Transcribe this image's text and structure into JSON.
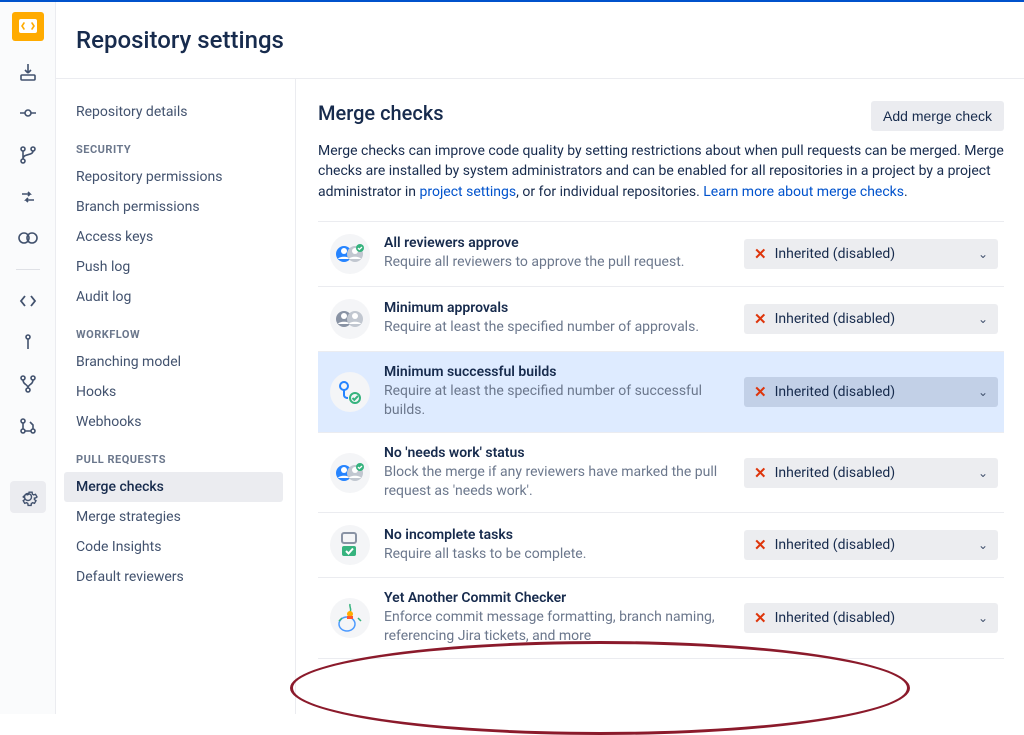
{
  "header": {
    "title": "Repository settings"
  },
  "settings_nav": {
    "top_item": "Repository details",
    "groups": [
      {
        "title": "SECURITY",
        "items": [
          "Repository permissions",
          "Branch permissions",
          "Access keys",
          "Push log",
          "Audit log"
        ]
      },
      {
        "title": "WORKFLOW",
        "items": [
          "Branching model",
          "Hooks",
          "Webhooks"
        ]
      },
      {
        "title": "PULL REQUESTS",
        "items": [
          "Merge checks",
          "Merge strategies",
          "Code Insights",
          "Default reviewers"
        ]
      }
    ],
    "active_item": "Merge checks"
  },
  "main": {
    "title": "Merge checks",
    "add_button": "Add merge check",
    "description_parts": {
      "pre": "Merge checks can improve code quality by setting restrictions about when pull requests can be merged. Merge checks are installed by system administrators and can be enabled for all repositories in a project by a project administrator in ",
      "link1": "project settings",
      "mid": ", or for individual repositories. ",
      "link2": "Learn more about merge checks",
      "post": "."
    },
    "checks": [
      {
        "title": "All reviewers approve",
        "desc": "Require all reviewers to approve the pull request.",
        "status": "Inherited (disabled)",
        "highlight": false,
        "icon": "avatars"
      },
      {
        "title": "Minimum approvals",
        "desc": "Require at least the specified number of approvals.",
        "status": "Inherited (disabled)",
        "highlight": false,
        "icon": "avatars-gray"
      },
      {
        "title": "Minimum successful builds",
        "desc": "Require at least the specified number of successful builds.",
        "status": "Inherited (disabled)",
        "highlight": true,
        "icon": "builds"
      },
      {
        "title": "No 'needs work' status",
        "desc": "Block the merge if any reviewers have marked the pull request as 'needs work'.",
        "status": "Inherited (disabled)",
        "highlight": false,
        "icon": "avatars"
      },
      {
        "title": "No incomplete tasks",
        "desc": "Require all tasks to be complete.",
        "status": "Inherited (disabled)",
        "highlight": false,
        "icon": "tasks"
      },
      {
        "title": "Yet Another Commit Checker",
        "desc": "Enforce commit message formatting, branch naming, referencing Jira tickets, and more",
        "status": "Inherited (disabled)",
        "highlight": false,
        "icon": "yacc"
      }
    ]
  }
}
